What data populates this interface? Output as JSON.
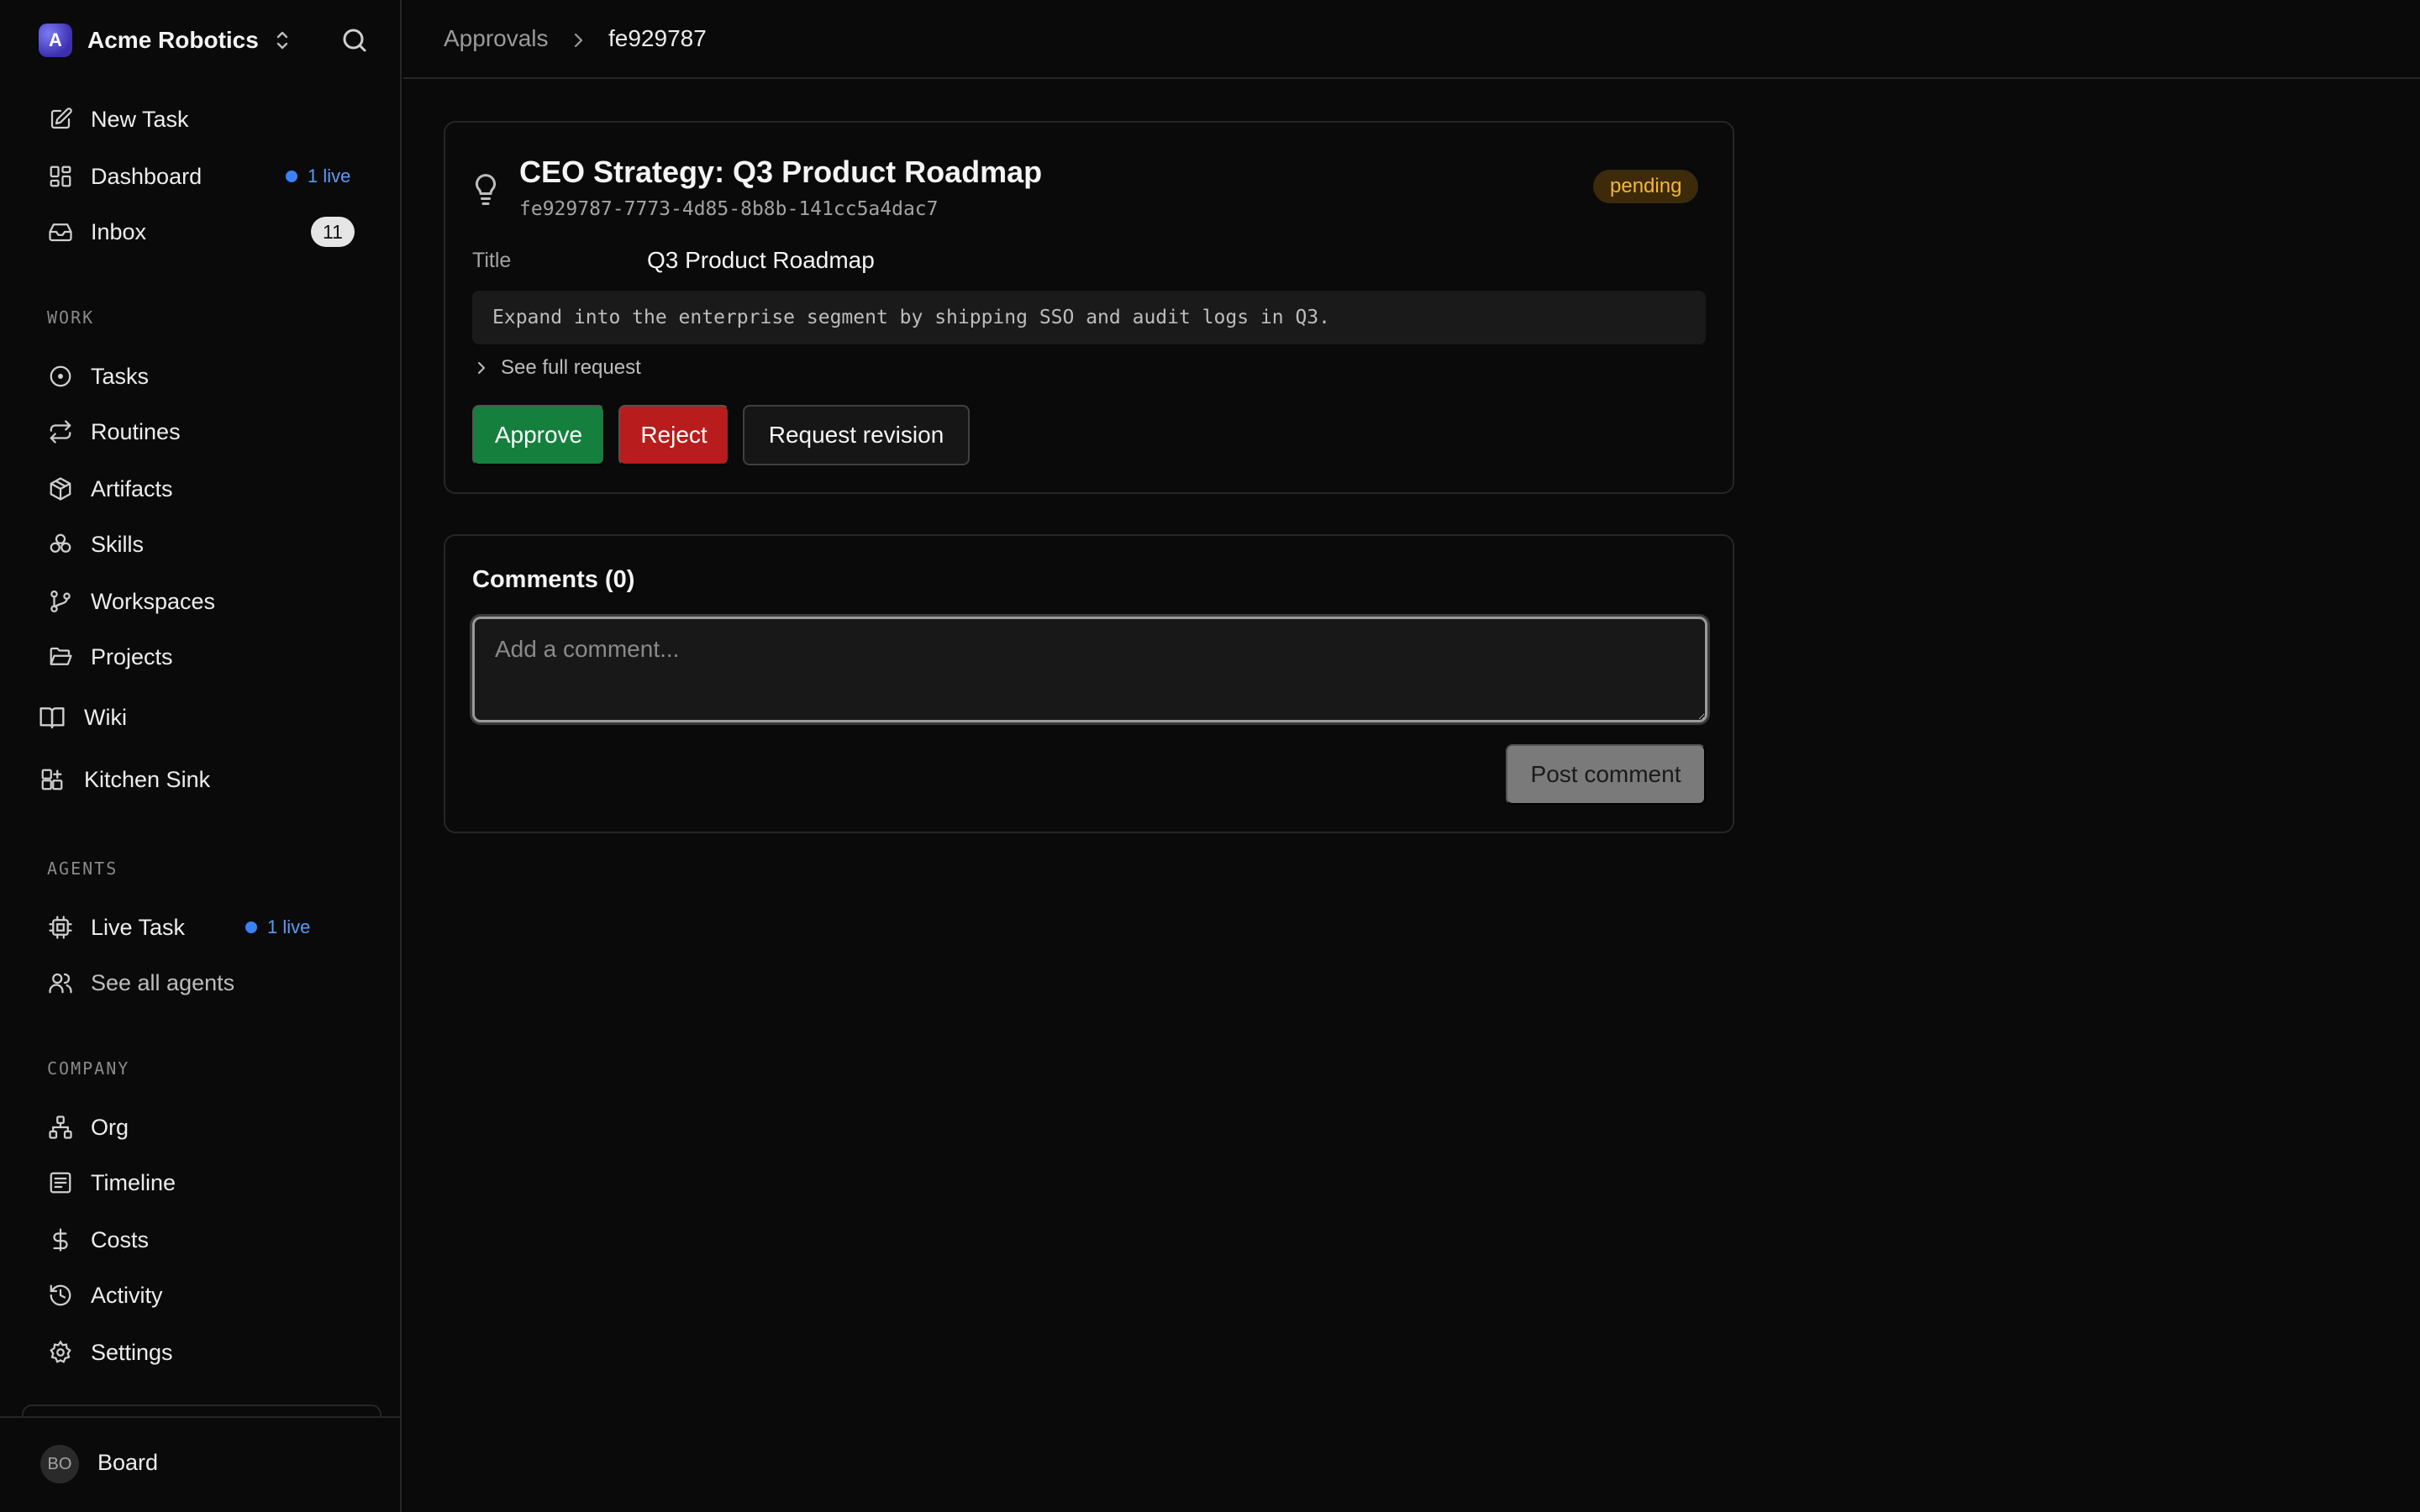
{
  "sidebar": {
    "brand": {
      "initial": "A",
      "name": "Acme Robotics"
    },
    "top_items": [
      {
        "label": "New Task",
        "icon": "pencil-square-icon"
      },
      {
        "label": "Dashboard",
        "icon": "dashboard-grid-icon",
        "live": "1 live"
      },
      {
        "label": "Inbox",
        "icon": "inbox-icon",
        "count": "11"
      }
    ],
    "sections": {
      "work": "WORK",
      "agents": "AGENTS",
      "company": "COMPANY"
    },
    "work_items": [
      {
        "label": "Tasks",
        "icon": "circle-dot-icon"
      },
      {
        "label": "Routines",
        "icon": "repeat-icon"
      },
      {
        "label": "Artifacts",
        "icon": "package-icon"
      },
      {
        "label": "Skills",
        "icon": "skills-icon"
      },
      {
        "label": "Workspaces",
        "icon": "git-branch-icon"
      },
      {
        "label": "Projects",
        "icon": "folder-open-icon"
      }
    ],
    "extra_items": [
      {
        "label": "Wiki",
        "icon": "book-icon"
      },
      {
        "label": "Kitchen Sink",
        "icon": "blocks-icon"
      }
    ],
    "agent_items": [
      {
        "label": "Live Task",
        "icon": "cpu-icon",
        "live": "1 live"
      },
      {
        "label": "See all agents",
        "icon": "users-icon"
      }
    ],
    "company_items": [
      {
        "label": "Org",
        "icon": "org-chart-icon"
      },
      {
        "label": "Timeline",
        "icon": "timeline-icon"
      },
      {
        "label": "Costs",
        "icon": "dollar-icon"
      },
      {
        "label": "Activity",
        "icon": "history-icon"
      },
      {
        "label": "Settings",
        "icon": "gear-icon"
      }
    ],
    "user": {
      "initials": "BO",
      "name": "Board"
    }
  },
  "breadcrumb": {
    "parent": "Approvals",
    "current": "fe929787"
  },
  "approval": {
    "title": "CEO Strategy: Q3 Product Roadmap",
    "id": "fe929787-7773-4d85-8b8b-141cc5a4dac7",
    "status": "pending",
    "field_label": "Title",
    "field_value": "Q3 Product Roadmap",
    "description": "Expand into the enterprise segment by shipping SSO and audit logs in Q3.",
    "see_full": "See full request",
    "approve_label": "Approve",
    "reject_label": "Reject",
    "revision_label": "Request revision"
  },
  "comments": {
    "title": "Comments (0)",
    "placeholder": "Add a comment...",
    "post_label": "Post comment"
  },
  "colors": {
    "background": "#0a0a0a",
    "approve": "#15803d",
    "reject": "#b91c1c",
    "pending_text": "#f5b731",
    "live_blue": "#3b82f6"
  }
}
